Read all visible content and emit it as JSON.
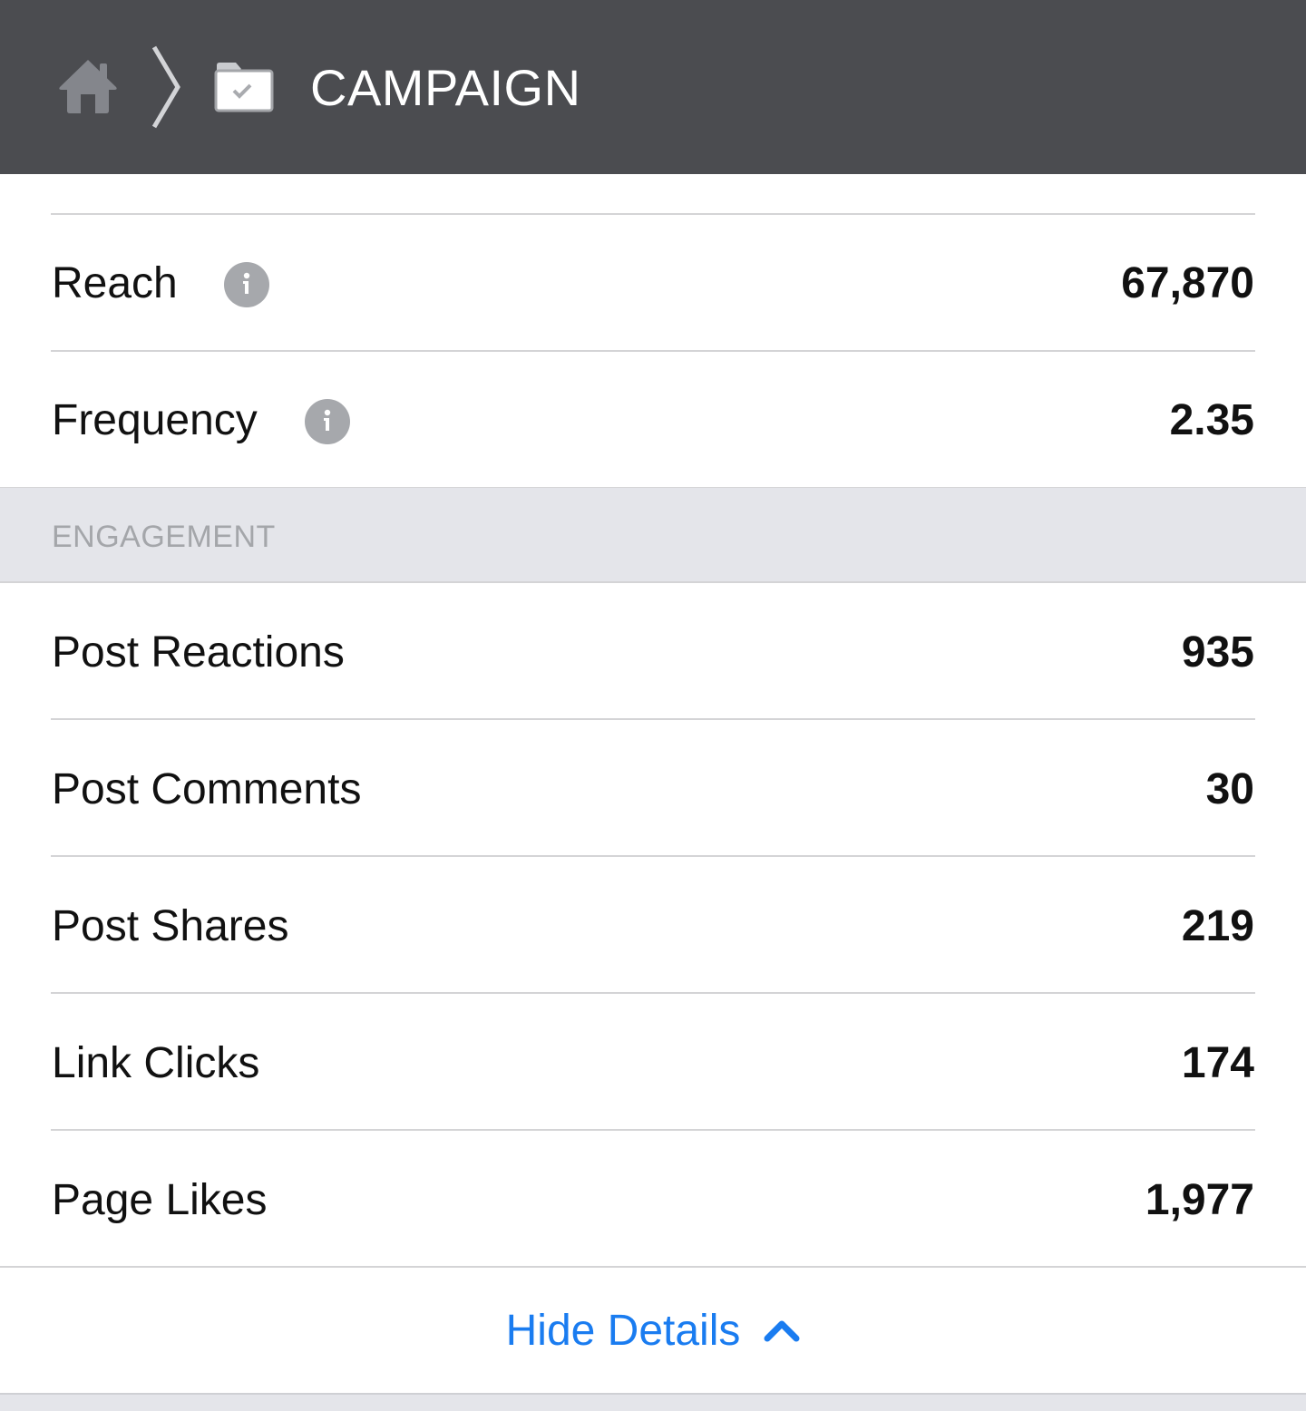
{
  "header": {
    "breadcrumb": [
      {
        "icon": "home-icon"
      },
      {
        "icon": "chevron-right-icon"
      },
      {
        "icon": "folder-check-icon"
      }
    ],
    "title": "CAMPAIGN",
    "background_color": "#4b4c50"
  },
  "performance": {
    "rows": [
      {
        "label": "Reach",
        "value": "67,870",
        "has_info_icon": true
      },
      {
        "label": "Frequency",
        "value": "2.35",
        "has_info_icon": true
      }
    ]
  },
  "engagement": {
    "section_title": "ENGAGEMENT",
    "rows": [
      {
        "label": "Post Reactions",
        "value": "935"
      },
      {
        "label": "Post Comments",
        "value": "30"
      },
      {
        "label": "Post Shares",
        "value": "219"
      },
      {
        "label": "Link Clicks",
        "value": "174"
      },
      {
        "label": "Page Likes",
        "value": "1,977"
      }
    ]
  },
  "footer": {
    "toggle_label": "Hide Details",
    "toggle_icon": "chevron-up-icon",
    "accent_color": "#1a7cf0"
  }
}
